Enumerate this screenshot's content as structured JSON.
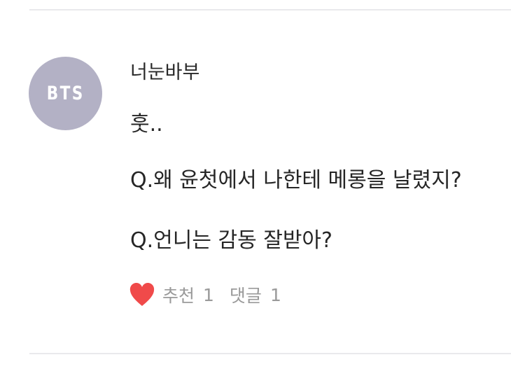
{
  "post": {
    "avatar_text": "BTS",
    "username": "너눈바부",
    "lines": [
      "훗..",
      "Q.왜 윤첫에서 나한테 메롱을 날렸지?",
      "Q.언니는 감동 잘받아?"
    ],
    "like_label": "추천",
    "like_count": "1",
    "comment_label": "댓글",
    "comment_count": "1",
    "heart_icon": "heart-icon",
    "heart_color": "#f04a4a"
  }
}
